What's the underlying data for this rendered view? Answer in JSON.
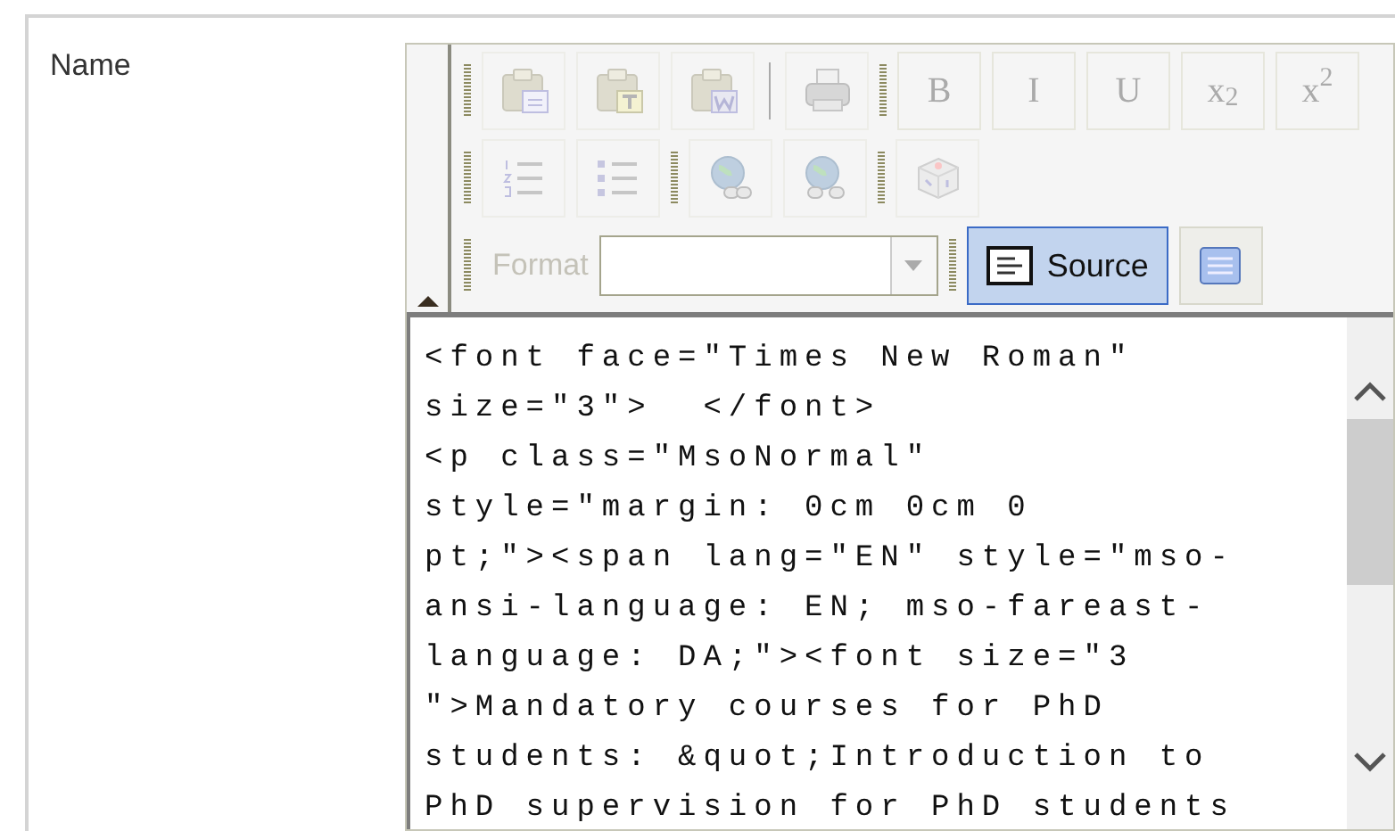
{
  "field_label": "Name",
  "toolbar_rows": [
    [
      {
        "group": [
          {
            "kind": "paste",
            "disabled": true,
            "on": false
          },
          {
            "kind": "paste-text",
            "disabled": true,
            "on": false
          },
          {
            "kind": "paste-word",
            "disabled": true,
            "on": false
          },
          {
            "kind": "separator"
          },
          {
            "kind": "print",
            "disabled": true,
            "on": false
          }
        ]
      },
      {
        "group": [
          {
            "kind": "text",
            "label": "B",
            "disabled": true,
            "on": false
          },
          {
            "kind": "text",
            "label": "I",
            "disabled": true,
            "on": false
          },
          {
            "kind": "text",
            "label": "U",
            "disabled": true,
            "on": false
          },
          {
            "kind": "text",
            "label": "x$_{2}$",
            "disabled": true,
            "on": false
          },
          {
            "kind": "text",
            "label": "x$^{2}$",
            "disabled": true,
            "on": false
          }
        ]
      }
    ],
    [
      {
        "group": [
          {
            "kind": "numbered-list",
            "disabled": true,
            "on": false
          },
          {
            "kind": "bulleted-list",
            "disabled": true,
            "on": false
          }
        ]
      },
      {
        "group": [
          {
            "kind": "link",
            "disabled": true,
            "on": false
          },
          {
            "kind": "unlink",
            "disabled": true,
            "on": false
          }
        ]
      },
      {
        "group": [
          {
            "kind": "object",
            "disabled": true,
            "on": false
          }
        ]
      }
    ],
    [
      {
        "group": [
          {
            "kind": "format",
            "label": "Format",
            "disabled": true
          }
        ]
      },
      {
        "group": [
          {
            "kind": "source",
            "label": "Source",
            "disabled": false,
            "on": true
          },
          {
            "kind": "maximize",
            "disabled": false,
            "on": false
          }
        ]
      }
    ]
  ],
  "source_lines": [
    "<font face=\"Times New Roman\"",
    "size=\"3\">  </font>",
    "<p class=\"MsoNormal\"",
    "style=\"margin: 0cm 0cm 0",
    "pt;\"><span lang=\"EN\" style=\"mso-",
    "ansi-language: EN; mso-fareast-",
    "language: DA;\"><font size=\"3",
    "\">Mandatory courses for PhD",
    "students: &quot;Introduction to",
    "PhD supervision for PhD students"
  ]
}
